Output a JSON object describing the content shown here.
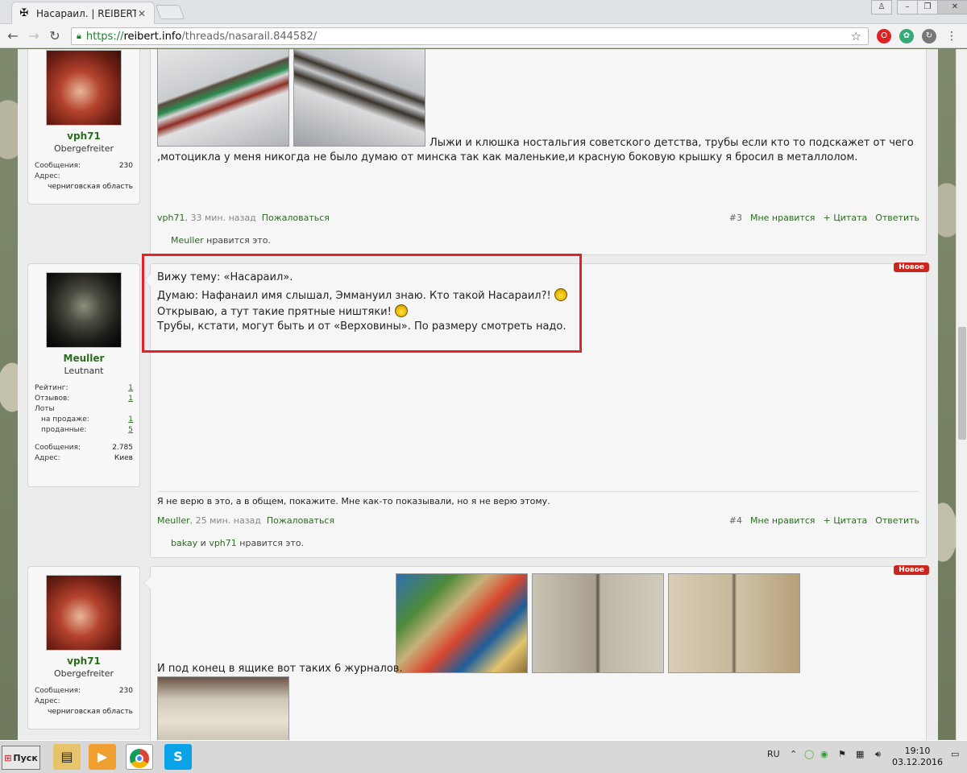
{
  "browser": {
    "tab_title": "Насараил. | REIBERT.info",
    "tab_close": "✕",
    "url_scheme": "https://",
    "url_host": "reibert.info",
    "url_path": "/threads/nasarail.844582/"
  },
  "posts": [
    {
      "user": {
        "name": "vph71",
        "title": "Obergefreiter",
        "messages_label": "Сообщения:",
        "messages": "230",
        "address_label": "Адрес:",
        "address": "черниговская область"
      },
      "text_lines": [
        "Лыжи и клюшка ностальгия советского детства, трубы если кто то подскажет от чего",
        ",мотоцикла у меня никогда не было думаю от минска так как маленькие,и красную боковую крышку я бросил в металлолом."
      ],
      "meta_user": "vph71",
      "meta_time": "33 мин. назад",
      "report": "Пожаловаться",
      "num": "#3",
      "like": "Мне нравится",
      "quote": "+ Цитата",
      "reply": "Ответить",
      "likes_users": [
        "Meuller"
      ],
      "likes_suffix": "нравится это."
    },
    {
      "user": {
        "name": "Meuller",
        "title": "Leutnant",
        "rating_label": "Рейтинг:",
        "rating": "1",
        "reviews_label": "Отзывов:",
        "reviews": "1",
        "lots_label": "Лоты",
        "onsale_label": "на продаже:",
        "onsale": "1",
        "sold_label": "проданные:",
        "sold": "5",
        "messages_label": "Сообщения:",
        "messages": "2.785",
        "address_label": "Адрес:",
        "address": "Киев"
      },
      "badge": "Новое",
      "lines": [
        "Вижу тему: «Насараил».",
        "Думаю: Нафанаил имя слышал, Эммануил знаю. Кто такой Насараил?!",
        "Открываю, а тут такие прятные ништяки!",
        "Трубы, кстати, могут быть и от «Верховины». По размеру смотреть надо."
      ],
      "signature": "Я не верю в это, а в общем, покажите. Мне как-то показывали, но я не верю этому.",
      "meta_user": "Meuller",
      "meta_time": "25 мин. назад",
      "report": "Пожаловаться",
      "num": "#4",
      "like": "Мне нравится",
      "quote": "+ Цитата",
      "reply": "Ответить",
      "likes_users": [
        "bakay",
        "vph71"
      ],
      "likes_and": "и",
      "likes_suffix": "нравится это."
    },
    {
      "user": {
        "name": "vph71",
        "title": "Obergefreiter",
        "messages_label": "Сообщения:",
        "messages": "230",
        "address_label": "Адрес:",
        "address": "черниговская область"
      },
      "badge": "Новое",
      "text": "И под конец в ящике вот таких 6 журналов."
    }
  ],
  "taskbar": {
    "start": "Пуск",
    "lang": "RU",
    "time": "19:10",
    "date": "03.12.2016"
  },
  "colors": {
    "accent_green": "#2a6b1f",
    "badge_red": "#c8261f",
    "highlight_box": "#e3232c"
  }
}
